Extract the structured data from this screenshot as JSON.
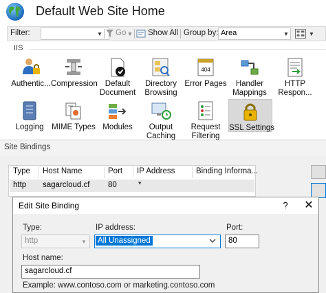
{
  "header": {
    "title": "Default Web Site Home"
  },
  "filterbar": {
    "filter_label": "Filter:",
    "filter_value": "",
    "go_label": "Go",
    "show_all_label": "Show All",
    "group_by_label": "Group by:",
    "group_by_value": "Area"
  },
  "section": {
    "label": "IIS"
  },
  "features": [
    {
      "line1": "Authentic...",
      "line2": "",
      "icon": "users-lock-icon"
    },
    {
      "line1": "Compression",
      "line2": "",
      "icon": "compression-vise-icon"
    },
    {
      "line1": "Default",
      "line2": "Document",
      "icon": "default-document-icon"
    },
    {
      "line1": "Directory",
      "line2": "Browsing",
      "icon": "directory-browsing-icon"
    },
    {
      "line1": "Error Pages",
      "line2": "",
      "icon": "error-404-icon"
    },
    {
      "line1": "Handler",
      "line2": "Mappings",
      "icon": "handler-mappings-icon"
    },
    {
      "line1": "HTTP",
      "line2": "Respon...",
      "icon": "http-response-icon"
    },
    {
      "line1": "Logging",
      "line2": "",
      "icon": "logging-icon"
    },
    {
      "line1": "MIME Types",
      "line2": "",
      "icon": "mime-types-icon"
    },
    {
      "line1": "Modules",
      "line2": "",
      "icon": "modules-icon"
    },
    {
      "line1": "Output",
      "line2": "Caching",
      "icon": "output-caching-icon"
    },
    {
      "line1": "Request",
      "line2": "Filtering",
      "icon": "request-filtering-icon"
    },
    {
      "line1": "SSL Settings",
      "line2": "",
      "icon": "ssl-lock-icon"
    }
  ],
  "icon_numbers": {
    "error_pages": "404"
  },
  "bindings": {
    "title": "Site Bindings",
    "columns": [
      "Type",
      "Host Name",
      "Port",
      "IP Address",
      "Binding Informa..."
    ],
    "rows": [
      {
        "type": "http",
        "host": "sagarcloud.cf",
        "port": "80",
        "ip": "*",
        "info": ""
      }
    ]
  },
  "dialog": {
    "title": "Edit Site Binding",
    "help": "?",
    "close": "✕",
    "type_label": "Type:",
    "type_value": "http",
    "ip_label": "IP address:",
    "ip_value": "All Unassigned",
    "port_label": "Port:",
    "port_value": "80",
    "hostname_label": "Host name:",
    "hostname_value": "sagarcloud.cf",
    "example": "Example: www.contoso.com or marketing.contoso.com"
  },
  "colors": {
    "accent": "#0078d7",
    "selected_tile": "#d9d9d9"
  }
}
